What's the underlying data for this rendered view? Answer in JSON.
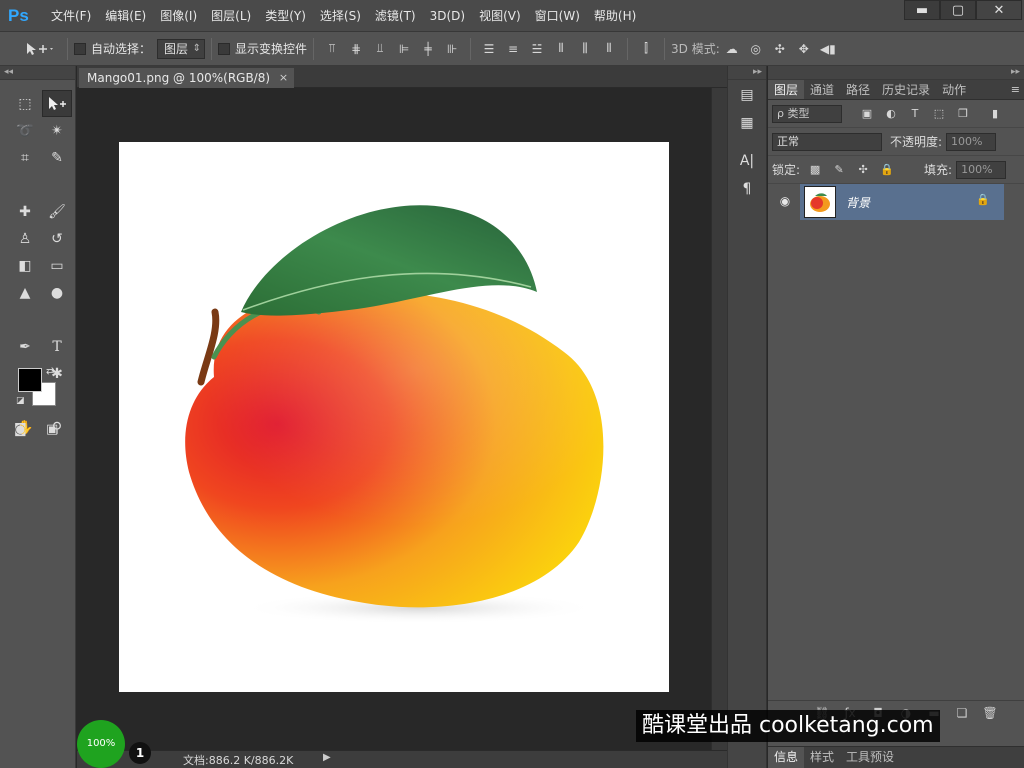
{
  "app": {
    "logo": "Ps",
    "menu": [
      "文件(F)",
      "编辑(E)",
      "图像(I)",
      "图层(L)",
      "类型(Y)",
      "选择(S)",
      "滤镜(T)",
      "3D(D)",
      "视图(V)",
      "窗口(W)",
      "帮助(H)"
    ],
    "window_controls": {
      "minimize": "▬",
      "maximize": "▢",
      "close": "✕"
    }
  },
  "options_bar": {
    "tool_icon": "move-tool-icon",
    "auto_select_label": "自动选择：",
    "auto_select_target": "图层",
    "show_transform_label": "显示变换控件",
    "mode_3d_label": "3D 模式:"
  },
  "document": {
    "tab_title": "Mango01.png @ 100%(RGB/8)",
    "tab_close": "×",
    "zoom": "100%",
    "recorder_badge": "1",
    "doc_info": "文档:886.2 K/886.2K",
    "canvas_background": "#ffffff"
  },
  "toolbox": {
    "collapse": "◂◂",
    "foreground_color": "#000000",
    "background_color": "#ffffff"
  },
  "layers_panel": {
    "tabs": [
      "图层",
      "通道",
      "路径",
      "历史记录",
      "动作"
    ],
    "active_tab": "图层",
    "filter_kind": "ρ 类型",
    "blend_mode": "正常",
    "opacity_label": "不透明度:",
    "opacity_value": "100%",
    "lock_label": "锁定:",
    "fill_label": "填充:",
    "fill_value": "100%",
    "layers": [
      {
        "name": "背景",
        "visible": true,
        "locked": true,
        "selected": true
      }
    ]
  },
  "bottom_panel": {
    "tabs": [
      "信息",
      "样式",
      "工具预设"
    ],
    "active_tab": "信息"
  },
  "watermark": "酷课堂出品 coolketang.com",
  "colors": {
    "ps_blue": "#31a8ff",
    "layer_selected": "#59708f",
    "zoom_badge": "#1fa31f"
  }
}
